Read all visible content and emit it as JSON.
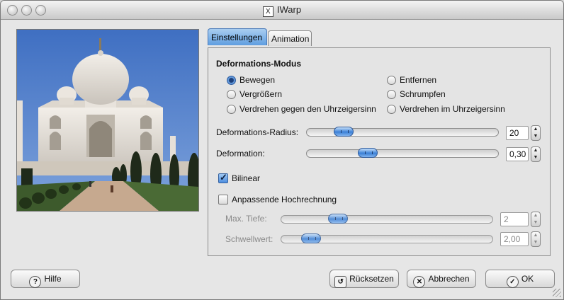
{
  "window": {
    "app_badge": "X",
    "title": "IWarp"
  },
  "tabs": [
    {
      "label": "Einstellungen",
      "active": true
    },
    {
      "label": "Animation",
      "active": false
    }
  ],
  "settings": {
    "group_title": "Deformations-Modus",
    "modes": [
      {
        "label": "Bewegen",
        "checked": true
      },
      {
        "label": "Entfernen",
        "checked": false
      },
      {
        "label": "Vergrößern",
        "checked": false
      },
      {
        "label": "Schrumpfen",
        "checked": false
      },
      {
        "label": "Verdrehen gegen den Uhrzeigersinn",
        "checked": false
      },
      {
        "label": "Verdrehen im Uhrzeigersinn",
        "checked": false
      }
    ],
    "radius": {
      "label": "Deformations-Radius:",
      "value": "20",
      "slider_fraction": 0.07
    },
    "deformation": {
      "label": "Deformation:",
      "value": "0,30",
      "slider_fraction": 0.3
    },
    "bilinear": {
      "label": "Bilinear",
      "checked": true
    },
    "adaptive": {
      "label": "Anpassende Hochrechnung",
      "checked": false
    },
    "max_depth": {
      "label": "Max. Tiefe:",
      "value": "2",
      "slider_fraction": 0.22,
      "enabled": false
    },
    "threshold": {
      "label": "Schwellwert:",
      "value": "2,00",
      "slider_fraction": 0.08,
      "enabled": false
    }
  },
  "buttons": {
    "help": "Hilfe",
    "reset": "Rücksetzen",
    "cancel": "Abbrechen",
    "ok": "OK"
  },
  "icons": {
    "help": "question-circle-icon",
    "reset": "reset-icon",
    "cancel": "cancel-x-icon",
    "ok": "check-icon"
  },
  "colors": {
    "active_tab": "#5f9ee0",
    "slider_thumb": "#3a7fd6",
    "sky": "#4e7fcf"
  }
}
